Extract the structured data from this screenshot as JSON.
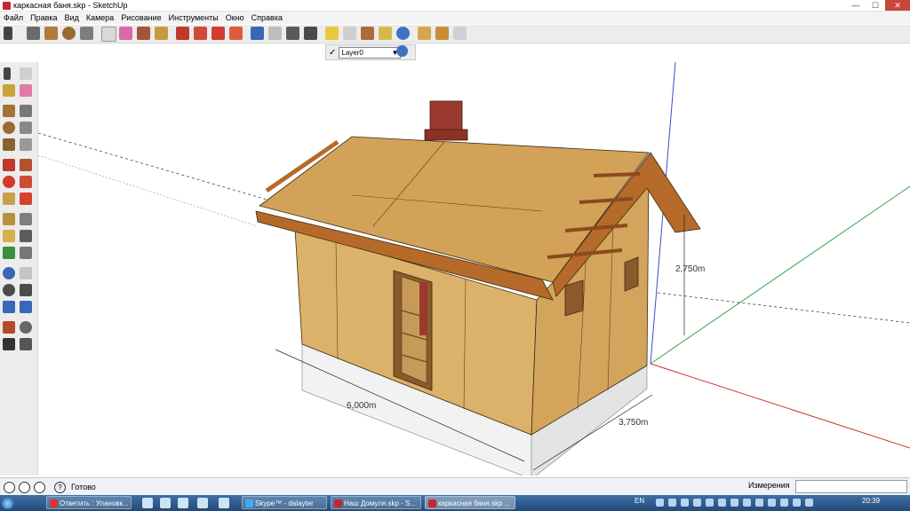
{
  "window": {
    "title": "каркасная баня.skp - SketchUp",
    "min_label": "—",
    "max_label": "☐",
    "close_label": "✕"
  },
  "menu": [
    "Файл",
    "Правка",
    "Вид",
    "Камера",
    "Рисование",
    "Инструменты",
    "Окно",
    "Справка"
  ],
  "toolbar": {
    "icons": [
      "select-icon",
      "pencil-icon",
      "rectangle-icon",
      "circle-icon",
      "arc-icon",
      "eraser-icon",
      "paint-bucket-icon",
      "push-pull-icon",
      "move-icon",
      "rotate-icon",
      "offset-icon",
      "orbit-icon",
      "pan-icon",
      "zoom-icon",
      "zoom-extents-icon",
      "warehouse-icon",
      "components-icon",
      "share-model-icon",
      "google-earth-icon",
      "extension-icon"
    ]
  },
  "layers": {
    "checked": "✓",
    "current": "Layer0",
    "arrow": "▼"
  },
  "model": {
    "dim_height": "2,750m",
    "dim_length": "6,000m",
    "dim_width": "3,750m"
  },
  "status": {
    "text": "Готово",
    "help": "?",
    "measure_label": "Измерения",
    "measure_value": ""
  },
  "taskbar": {
    "tasks": [
      {
        "label": "Ответить : Улановк...",
        "active": false
      },
      {
        "label": "Skype™ - dalayter",
        "active": false
      },
      {
        "label": "Наш Домуля.skp - S...",
        "active": false
      },
      {
        "label": "каркасная баня.skp ...",
        "active": true
      }
    ],
    "lang": "EN",
    "time": "20:39"
  },
  "colors": {
    "wall": "#dcb16a",
    "roof": "#d2a259",
    "rafter": "#b66a2a",
    "chimney": "#9a3a2e",
    "foundation": "#efefef",
    "axis_red": "#c0392b",
    "axis_green": "#3aa24a",
    "axis_blue": "#3a4fc8"
  }
}
